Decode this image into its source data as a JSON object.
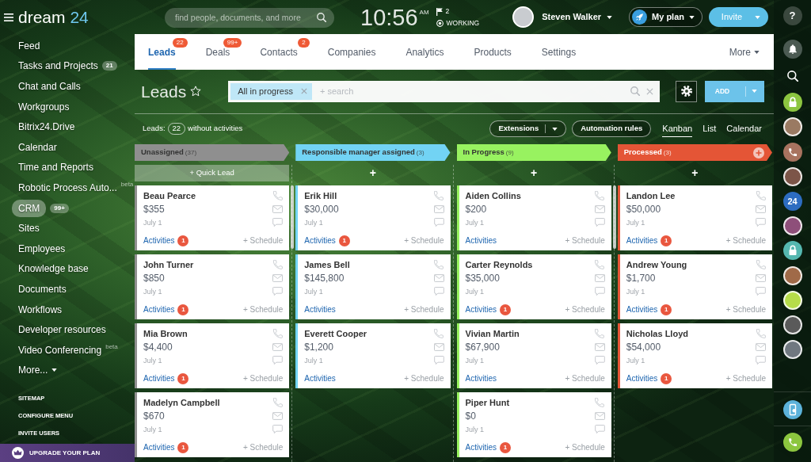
{
  "topbar": {
    "logo": {
      "word": "dream",
      "number": "24"
    },
    "search_placeholder": "find people, documents, and more",
    "clock": {
      "time": "10:56",
      "meridiem": "AM"
    },
    "flag_count": "2",
    "work_status": "WORKING",
    "user_name": "Steven Walker",
    "plan_button": "My plan",
    "invite_button": "Invite"
  },
  "sidebar": {
    "items": [
      {
        "label": "Feed",
        "selected": false
      },
      {
        "label": "Tasks and Projects",
        "badge": "21",
        "selected": false
      },
      {
        "label": "Chat and Calls",
        "selected": false
      },
      {
        "label": "Workgroups",
        "selected": false
      },
      {
        "label": "Bitrix24.Drive",
        "selected": false
      },
      {
        "label": "Calendar",
        "selected": false
      },
      {
        "label": "Time and Reports",
        "selected": false
      },
      {
        "label": "Robotic Process Auto...",
        "tag": "beta",
        "selected": false
      },
      {
        "label": "CRM",
        "badge": "99+",
        "selected": true
      },
      {
        "label": "Sites",
        "selected": false
      },
      {
        "label": "Employees",
        "selected": false
      },
      {
        "label": "Knowledge base",
        "selected": false
      },
      {
        "label": "Documents",
        "selected": false
      },
      {
        "label": "Workflows",
        "selected": false
      },
      {
        "label": "Developer resources",
        "selected": false
      },
      {
        "label": "Video Conferencing",
        "tag": "beta",
        "selected": false
      }
    ],
    "more": "More...",
    "links": [
      "SITEMAP",
      "CONFIGURE MENU",
      "INVITE USERS"
    ],
    "upgrade": "UPGRADE YOUR PLAN"
  },
  "tabs": [
    {
      "label": "Leads",
      "badge": "22",
      "selected": true
    },
    {
      "label": "Deals",
      "badge": "99+",
      "selected": false
    },
    {
      "label": "Contacts",
      "badge": "2",
      "selected": false
    },
    {
      "label": "Companies",
      "selected": false
    },
    {
      "label": "Analytics",
      "selected": false
    },
    {
      "label": "Products",
      "selected": false
    },
    {
      "label": "Settings",
      "selected": false
    }
  ],
  "tabs_more": "More",
  "header": {
    "title": "Leads",
    "starred": false,
    "filter_tag": "All in progress",
    "search_placeholder": "+ search",
    "add_button": "ADD"
  },
  "summary": {
    "label": "Leads:",
    "count": "22",
    "text": "without activities"
  },
  "toolbar": {
    "buttons": [
      {
        "label": "Extensions",
        "dropdown": true
      },
      {
        "label": "Automation rules",
        "dropdown": false
      }
    ],
    "views": [
      {
        "label": "Kanban",
        "selected": true
      },
      {
        "label": "List",
        "selected": false
      },
      {
        "label": "Calendar",
        "selected": false
      }
    ]
  },
  "columns": [
    {
      "title": "Unassigned",
      "count": "(37)",
      "color": "#8f8f8f",
      "add_stage_button": false,
      "scrollbar": true,
      "add_row": {
        "kind": "bar",
        "text": "+ Quick Lead"
      },
      "cards": [
        {
          "name": "Beau Pearce",
          "amount": "$355",
          "date": "July 1",
          "activities": "Activities",
          "badge": "1",
          "schedule": "+ Schedule"
        },
        {
          "name": "John Turner",
          "amount": "$850",
          "date": "July 1",
          "activities": "Activities",
          "badge": "1",
          "schedule": "+ Schedule"
        },
        {
          "name": "Mia Brown",
          "amount": "$4,400",
          "date": "July 1",
          "activities": "Activities",
          "badge": "1",
          "schedule": "+ Schedule"
        },
        {
          "name": "Madelyn Campbell",
          "amount": "$670",
          "date": "July 1",
          "activities": "Activities",
          "badge": "1",
          "schedule": "+ Schedule"
        }
      ]
    },
    {
      "title": "Responsible manager assigned",
      "count": "(3)",
      "color": "#72d3f4",
      "add_stage_button": false,
      "scrollbar": false,
      "add_row": {
        "kind": "plus",
        "text": "+"
      },
      "cards": [
        {
          "name": "Erik Hill",
          "amount": "$30,000",
          "date": "July 1",
          "activities": "Activities",
          "badge": "1",
          "schedule": "+ Schedule"
        },
        {
          "name": "James Bell",
          "amount": "$145,800",
          "date": "July 1",
          "activities": "Activities",
          "schedule": "+ Schedule"
        },
        {
          "name": "Everett Cooper",
          "amount": "$1,200",
          "date": "July 1",
          "activities": "Activities",
          "schedule": "+ Schedule"
        }
      ]
    },
    {
      "title": "In Progress",
      "count": "(9)",
      "color": "#98f260",
      "add_stage_button": false,
      "scrollbar": true,
      "add_row": {
        "kind": "plus",
        "text": "+"
      },
      "cards": [
        {
          "name": "Aiden Collins",
          "amount": "$200",
          "date": "July 1",
          "activities": "Activities",
          "schedule": "+ Schedule"
        },
        {
          "name": "Carter Reynolds",
          "amount": "$35,000",
          "date": "July 1",
          "activities": "Activities",
          "badge": "1",
          "schedule": "+ Schedule"
        },
        {
          "name": "Vivian Martin",
          "amount": "$67,900",
          "date": "July 1",
          "activities": "Activities",
          "schedule": "+ Schedule"
        },
        {
          "name": "Piper Hunt",
          "amount": "$0",
          "date": "July 1",
          "activities": "Activities",
          "badge": "1",
          "schedule": "+ Schedule"
        }
      ]
    },
    {
      "title": "Processed",
      "count": "(3)",
      "color": "#e45536",
      "add_stage_button": true,
      "scrollbar": false,
      "add_row": {
        "kind": "plus",
        "text": "+"
      },
      "cards": [
        {
          "name": "Landon Lee",
          "amount": "$50,000",
          "date": "July 1",
          "activities": "Activities",
          "badge": "1",
          "schedule": "+ Schedule"
        },
        {
          "name": "Andrew Young",
          "amount": "$1,700",
          "date": "July 1",
          "activities": "Activities",
          "badge": "1",
          "schedule": "+ Schedule"
        },
        {
          "name": "Nicholas Lloyd",
          "amount": "$54,000",
          "date": "July 1",
          "activities": "Activities",
          "badge": "1",
          "schedule": "+ Schedule"
        }
      ]
    }
  ],
  "rail": {
    "items": [
      {
        "kind": "help",
        "text": "?"
      },
      {
        "kind": "bell"
      },
      {
        "kind": "search"
      },
      {
        "kind": "lock",
        "color": "#8cc540"
      },
      {
        "kind": "avatar",
        "color": "#9a7a62"
      },
      {
        "kind": "phone",
        "color": "#a8735f"
      },
      {
        "kind": "avatar",
        "color": "#7c5548"
      },
      {
        "kind": "text",
        "text": "24",
        "color": "#2d6cc0"
      },
      {
        "kind": "avatar",
        "color": "#8e4f7a"
      },
      {
        "kind": "lock",
        "color": "#55b7b0"
      },
      {
        "kind": "avatar",
        "color": "#a06a48"
      },
      {
        "kind": "avatar",
        "color": "#b6dc4a"
      },
      {
        "kind": "avatar",
        "color": "#5a5a5a"
      },
      {
        "kind": "avatar",
        "color": "#707880"
      }
    ],
    "bottom": [
      {
        "kind": "device",
        "color": "#5cb2da"
      },
      {
        "kind": "phone",
        "color": "#8cc63f"
      }
    ]
  }
}
